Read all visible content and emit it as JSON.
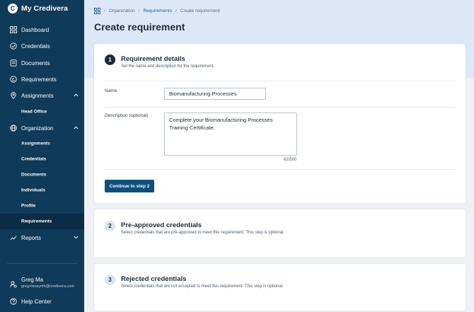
{
  "app": {
    "name": "My Credivera",
    "logo_letter": "C"
  },
  "sidebar": {
    "items": [
      {
        "label": "Dashboard",
        "icon": "dashboard-icon"
      },
      {
        "label": "Credentials",
        "icon": "badge-check-icon"
      },
      {
        "label": "Documents",
        "icon": "document-icon"
      },
      {
        "label": "Requirements",
        "icon": "requirements-icon"
      },
      {
        "label": "Assignments",
        "icon": "location-pin-icon"
      },
      {
        "label": "Organization",
        "icon": "globe-icon"
      },
      {
        "label": "Reports",
        "icon": "chart-icon"
      }
    ],
    "assignments_sub": [
      "Head Office"
    ],
    "organization_sub": [
      "Assignments",
      "Credentials",
      "Documents",
      "Individuals",
      "Profile",
      "Requirements"
    ],
    "active_sub": "Requirements",
    "user": {
      "name": "Greg Ma",
      "email": "greg+biosynth@credivera.com"
    },
    "help": "Help Center"
  },
  "breadcrumb": [
    "Organization",
    "Requirements",
    "Create requirement"
  ],
  "page_title": "Create requirement",
  "step1": {
    "number": "1",
    "title": "Requirement details",
    "subtitle": "Set the name and description for the requirement.",
    "name_label": "Name",
    "name_value": "Biomanufacturing Processes",
    "description_label": "Description (optional)",
    "description_value": "Complete your Biomanufacturing Processes Training Certificate.",
    "char_count": "62/500",
    "continue_label": "Continue to step 2"
  },
  "step2": {
    "number": "2",
    "title": "Pre-approved credentials",
    "subtitle": "Select credentials that are pre-approved to meet this requirement. This step is optional."
  },
  "step3": {
    "number": "3",
    "title": "Rejected credentials",
    "subtitle": "Select credentials that are not accepted to meet this requirement. This step is optional."
  },
  "colors": {
    "sidebar": "#0f3a5a",
    "accent": "#0f4f7c",
    "header_band": "#dce8f8",
    "background": "#eef1f5"
  }
}
